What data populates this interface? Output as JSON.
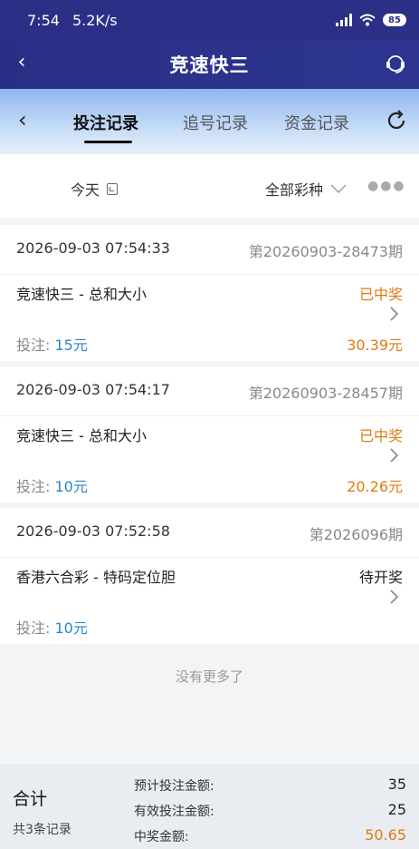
{
  "status_bar": {
    "time": "7:54",
    "speed": "5.2K/s",
    "battery": "85"
  },
  "app_bar": {
    "title": "竞速快三"
  },
  "tabs": [
    {
      "label": "投注记录",
      "active": true
    },
    {
      "label": "追号记录",
      "active": false
    },
    {
      "label": "资金记录",
      "active": false
    }
  ],
  "filters": {
    "date": "今天",
    "lottery_type": "全部彩种"
  },
  "records": [
    {
      "time": "2026-09-03 07:54:33",
      "issue": "第20260903-28473期",
      "game": "竞速快三 - 总和大小",
      "status": "已中奖",
      "bet_label": "投注: ",
      "bet_amount": "15元",
      "prize": "30.39元"
    },
    {
      "time": "2026-09-03 07:54:17",
      "issue": "第20260903-28457期",
      "game": "竞速快三 - 总和大小",
      "status": "已中奖",
      "bet_label": "投注: ",
      "bet_amount": "10元",
      "prize": "20.26元"
    },
    {
      "time": "2026-09-03 07:52:58",
      "issue": "第2026096期",
      "game": "香港六合彩 - 特码定位胆",
      "status": "待开奖",
      "bet_label": "投注: ",
      "bet_amount": "10元",
      "prize": ""
    }
  ],
  "no_more_text": "没有更多了",
  "summary": {
    "label": "合计",
    "count_text": "共3条记录",
    "rows": [
      {
        "label": "预计投注金额:",
        "value": "35"
      },
      {
        "label": "有效投注金额:",
        "value": "25"
      },
      {
        "label": "中奖金额:",
        "value": "50.65"
      }
    ]
  },
  "colors": {
    "header_bg": "#2b2f86",
    "win": "#e07a10",
    "bet_amount": "#2a86c9"
  }
}
